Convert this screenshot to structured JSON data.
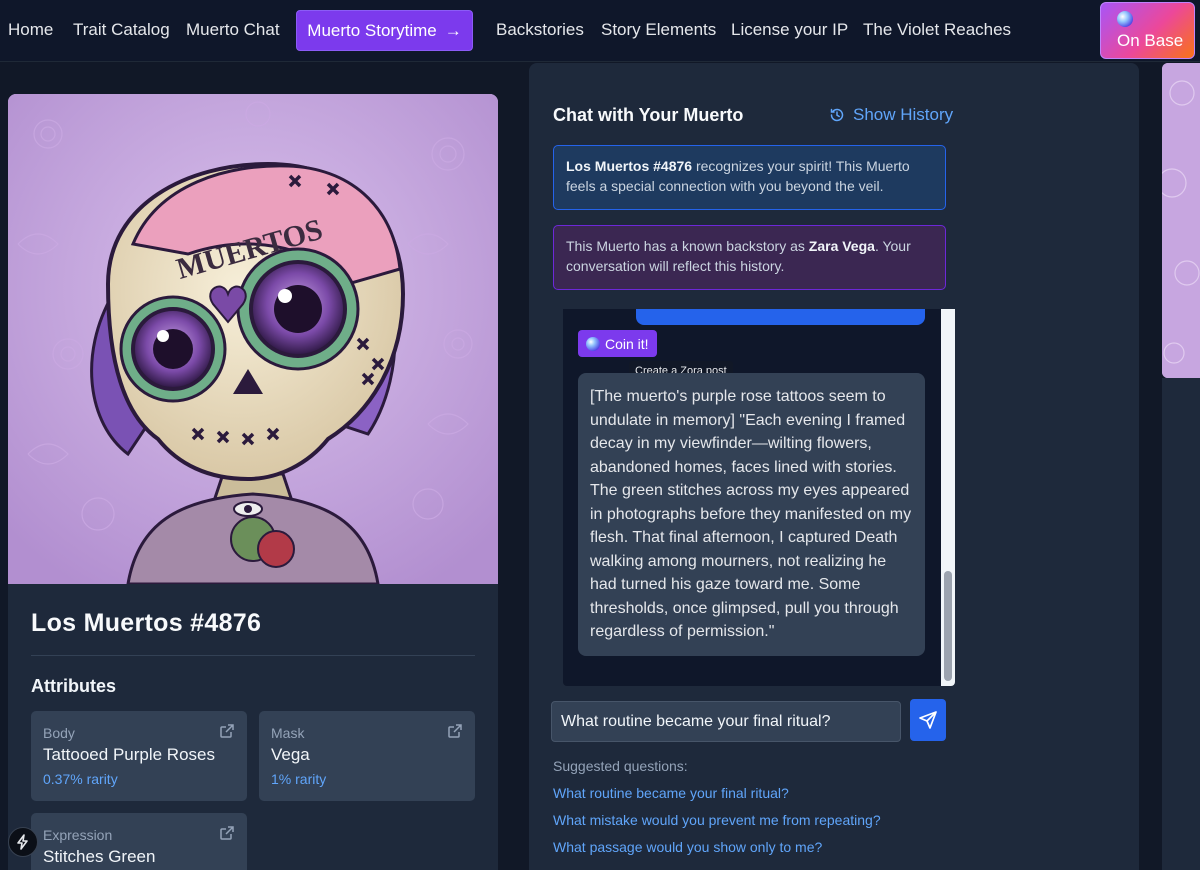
{
  "nav": {
    "links": [
      "Home",
      "Trait Catalog",
      "Muerto Chat"
    ],
    "cta_label": "Muerto Storytime",
    "cta_arrow": "→",
    "links_right": [
      "Backstories",
      "Story Elements",
      "License your IP",
      "The Violet Reaches"
    ],
    "onbase_label": "On Base"
  },
  "card": {
    "title": "Los Muertos #4876",
    "attributes_heading": "Attributes",
    "attributes": [
      {
        "label": "Body",
        "value": "Tattooed Purple Roses",
        "rarity": "0.37% rarity"
      },
      {
        "label": "Mask",
        "value": "Vega",
        "rarity": "1% rarity"
      },
      {
        "label": "Expression",
        "value": "Stitches Green",
        "rarity": ""
      }
    ],
    "art_text": "MUERTOS"
  },
  "chat": {
    "title": "Chat with Your Muerto",
    "history_label": "Show History",
    "notice_blue": {
      "bold": "Los Muertos #4876",
      "text": " recognizes your spirit! This Muerto feels a special connection with you beyond the veil."
    },
    "notice_purple": {
      "pre": "This Muerto has a known backstory as ",
      "bold": "Zara Vega",
      "post": ". Your conversation will reflect this history."
    },
    "coin_label": "Coin it!",
    "tooltip": "Create a Zora post",
    "bot_message": "[The muerto's purple rose tattoos seem to undulate in memory] \"Each evening I framed decay in my viewfinder—wilting flowers, abandoned homes, faces lined with stories. The green stitches across my eyes appeared in photographs before they manifested on my flesh. That final afternoon, I captured Death walking among mourners, not realizing he had turned his gaze toward me. Some thresholds, once glimpsed, pull you through regardless of permission.\"",
    "input_value": "What routine became your final ritual?",
    "suggested_label": "Suggested questions:",
    "suggestions": [
      "What routine became your final ritual?",
      "What mistake would you prevent me from repeating?",
      "What passage would you show only to me?"
    ]
  },
  "colors": {
    "accent_purple": "#7c3aed",
    "accent_blue": "#2563eb",
    "link_blue": "#60a5fa",
    "panel": "#1e293b",
    "background": "#111827"
  },
  "icons": [
    "history-icon",
    "external-link-icon",
    "send-icon",
    "bolt-icon",
    "coin-orb-icon"
  ]
}
